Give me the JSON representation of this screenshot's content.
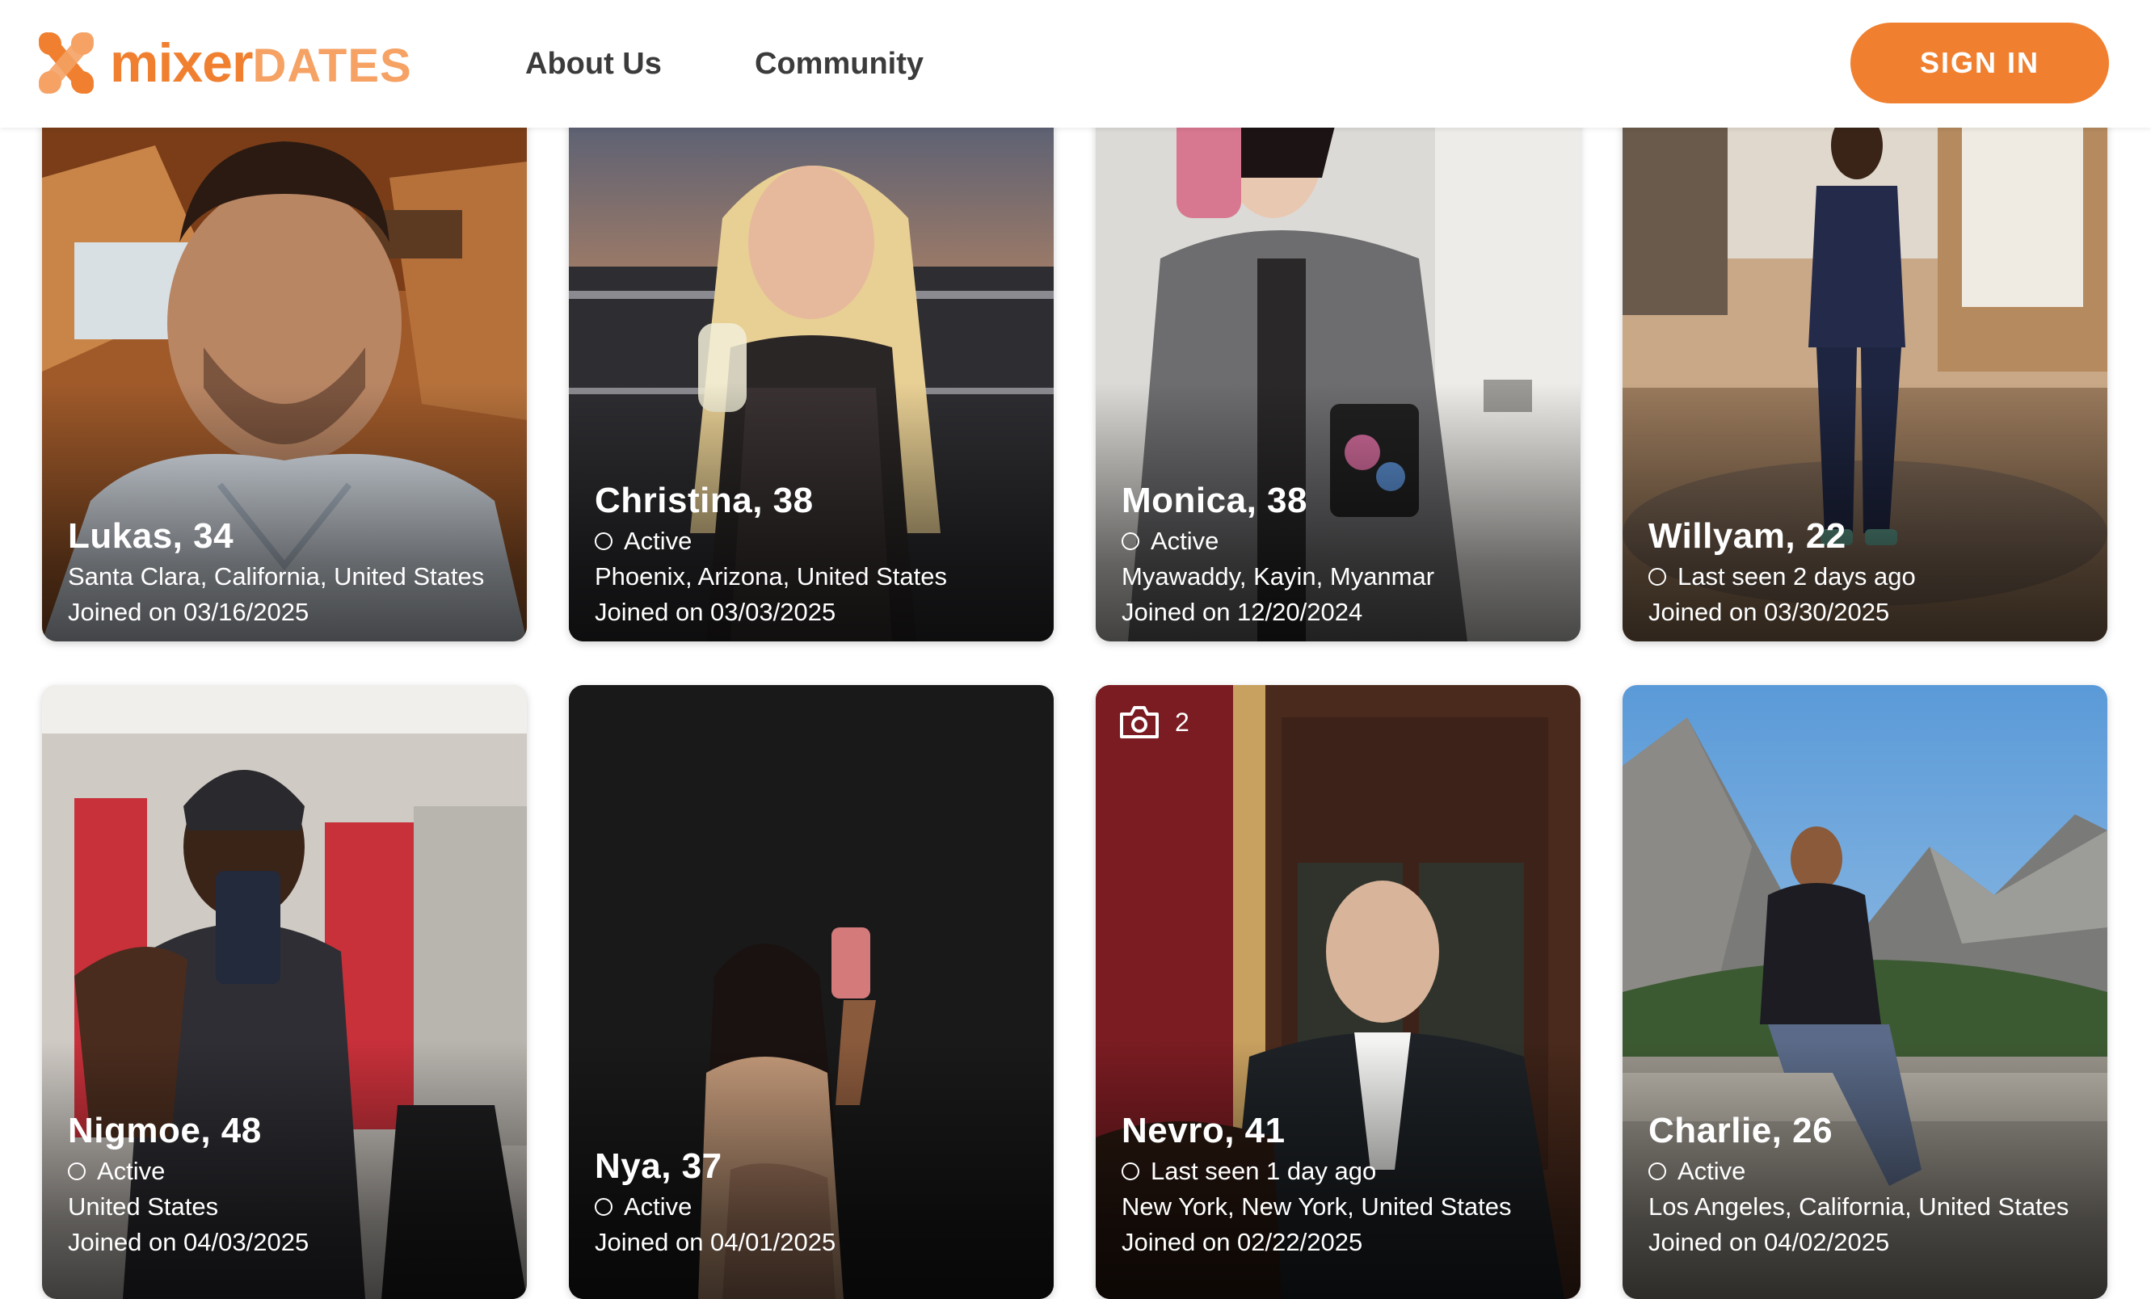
{
  "brand": {
    "name_part1": "mixer",
    "name_part2": "DATES",
    "accent": "#f08030",
    "accent_light": "#f5a264"
  },
  "nav": {
    "about": "About Us",
    "community": "Community"
  },
  "signin_label": "SIGN IN",
  "profiles": [
    {
      "name": "Lukas, 34",
      "status": "",
      "location": "Santa Clara, California, United States",
      "joined": "Joined on 03/16/2025"
    },
    {
      "name": "Christina, 38",
      "status": "Active",
      "location": "Phoenix, Arizona, United States",
      "joined": "Joined on 03/03/2025"
    },
    {
      "name": "Monica, 38",
      "status": "Active",
      "location": "Myawaddy, Kayin, Myanmar",
      "joined": "Joined on 12/20/2024"
    },
    {
      "name": "Willyam, 22",
      "status": "Last seen 2 days ago",
      "location": "",
      "joined": "Joined on 03/30/2025"
    },
    {
      "name": "Nigmoe, 48",
      "status": "Active",
      "location": "United States",
      "joined": "Joined on 04/03/2025"
    },
    {
      "name": "Nya, 37",
      "status": "Active",
      "location": "",
      "joined": "Joined on 04/01/2025"
    },
    {
      "name": "Nevro, 41",
      "status": "Last seen 1 day ago",
      "location": "New York, New York, United States",
      "joined": "Joined on 02/22/2025",
      "photo_count": "2"
    },
    {
      "name": "Charlie, 26",
      "status": "Active",
      "location": "Los Angeles, California, United States",
      "joined": "Joined on 04/02/2025"
    }
  ]
}
